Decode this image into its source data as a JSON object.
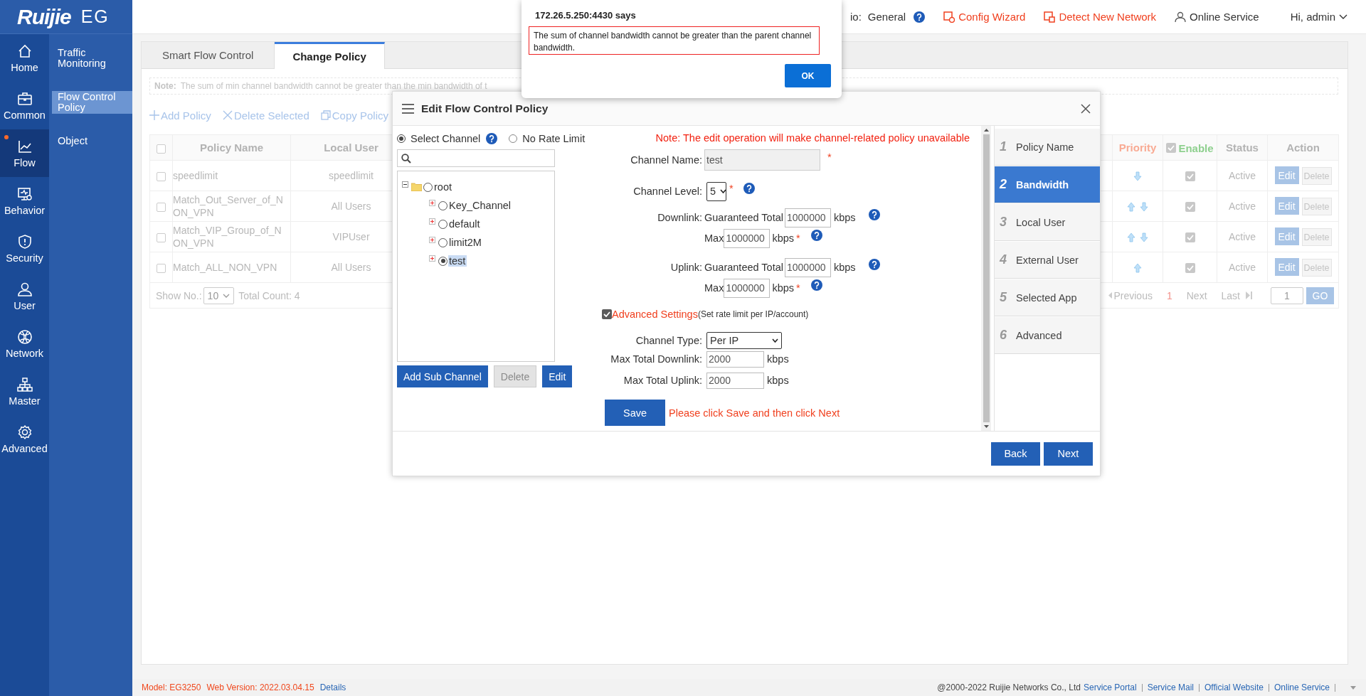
{
  "brand": {
    "logo": "Ruijie",
    "product": "EG"
  },
  "nav": {
    "items": [
      {
        "label": "Home",
        "selected": false,
        "dot": false
      },
      {
        "label": "Common",
        "selected": false,
        "dot": false
      },
      {
        "label": "Flow",
        "selected": true,
        "dot": true
      },
      {
        "label": "Behavior",
        "selected": false,
        "dot": false
      },
      {
        "label": "Security",
        "selected": false,
        "dot": false
      },
      {
        "label": "User",
        "selected": false,
        "dot": false
      },
      {
        "label": "Network",
        "selected": false,
        "dot": false
      },
      {
        "label": "Master",
        "selected": false,
        "dot": false
      },
      {
        "label": "Advanced",
        "selected": false,
        "dot": false
      }
    ],
    "subitems": [
      {
        "label": "Traffic Monitoring",
        "selected": false
      },
      {
        "label": "Flow Control Policy",
        "selected": true
      },
      {
        "label": "Object",
        "selected": false
      }
    ]
  },
  "header": {
    "scenario_label": "io:",
    "scenario": "General",
    "links": [
      {
        "label": "Config Wizard",
        "kind": "wizard"
      },
      {
        "label": "Detect New Network",
        "kind": "detect"
      },
      {
        "label": "Online Service",
        "kind": "service"
      }
    ],
    "user": "Hi, admin"
  },
  "tabs": [
    {
      "label": "Smart Flow Control",
      "selected": false
    },
    {
      "label": "Change Policy",
      "selected": true
    }
  ],
  "note": {
    "label": "Note:",
    "text": "The sum of min channel bandwidth cannot be greater than the min bandwidth of t"
  },
  "toolbar": [
    {
      "label": "Add Policy",
      "kind": "add"
    },
    {
      "label": "Delete Selected",
      "kind": "delete"
    },
    {
      "label": "Copy Policy",
      "kind": "copy"
    }
  ],
  "table": {
    "columns": {
      "policy_name": "Policy Name",
      "local_user": "Local User",
      "priority": "Priority",
      "enable": "Enable",
      "status": "Status",
      "action": "Action"
    },
    "select_all": false,
    "enable_all": true,
    "rows": [
      {
        "checked": false,
        "policy_name": "speedlimit",
        "local_user": "speedlimit",
        "priority_up": false,
        "priority_down": true,
        "enabled": true,
        "status": "Active",
        "edit": "Edit",
        "delete": "Delete"
      },
      {
        "checked": false,
        "policy_name": "Match_Out_Server_of_NON_VPN",
        "local_user": "All Users",
        "priority_up": true,
        "priority_down": true,
        "enabled": true,
        "status": "Active",
        "edit": "Edit",
        "delete": "Delete"
      },
      {
        "checked": false,
        "policy_name": "Match_VIP_Group_of_NON_VPN",
        "local_user": "VIPUser",
        "priority_up": true,
        "priority_down": true,
        "enabled": true,
        "status": "Active",
        "edit": "Edit",
        "delete": "Delete"
      },
      {
        "checked": false,
        "policy_name": "Match_ALL_NON_VPN",
        "local_user": "All Users",
        "priority_up": true,
        "priority_down": false,
        "enabled": true,
        "status": "Active",
        "edit": "Edit",
        "delete": "Delete"
      }
    ]
  },
  "pagination": {
    "show_label": "Show No.:",
    "page_size": "10",
    "total": "Total Count: 4",
    "previous": "Previous",
    "current": "1",
    "next": "Next",
    "last": "Last",
    "page_input": "1",
    "go": "GO"
  },
  "modal": {
    "title": "Edit Flow Control Policy",
    "rate_options": [
      {
        "label": "Select Channel",
        "selected": true
      },
      {
        "label": "No Rate Limit",
        "selected": false
      }
    ],
    "tree": {
      "label": "root",
      "expanded": true,
      "selected": false,
      "children": [
        {
          "label": "Key_Channel",
          "expanded": false,
          "selected": false
        },
        {
          "label": "default",
          "expanded": false,
          "selected": false
        },
        {
          "label": "limit2M",
          "expanded": false,
          "selected": false
        },
        {
          "label": "test",
          "expanded": false,
          "selected": true
        }
      ]
    },
    "tree_buttons": [
      {
        "label": "Add Sub Channel",
        "disabled": false
      },
      {
        "label": "Delete",
        "disabled": true
      },
      {
        "label": "Edit",
        "disabled": false
      }
    ],
    "note": "Note: The edit operation will make channel-related policy unavailable",
    "channel_name": {
      "label": "Channel Name:",
      "value": "test",
      "disabled": true,
      "required": "*"
    },
    "channel_level": {
      "label": "Channel Level:",
      "value": "5",
      "required": "*"
    },
    "links": [
      {
        "label": "Downlink:",
        "guaranteed_label": "Guaranteed Total",
        "guaranteed": "1000000",
        "guaranteed_unit": "kbps",
        "max_label": "Max",
        "max": "1000000",
        "max_unit": "kbps",
        "required": "*"
      },
      {
        "label": "Uplink:",
        "guaranteed_label": "Guaranteed Total",
        "guaranteed": "1000000",
        "guaranteed_unit": "kbps",
        "max_label": "Max",
        "max": "1000000",
        "max_unit": "kbps",
        "required": "*"
      }
    ],
    "advanced": {
      "checked": true,
      "label": "Advanced Settings",
      "hint": "(Set rate limit per IP/account)"
    },
    "channel_type": {
      "label": "Channel Type:",
      "value": "Per IP"
    },
    "totals": [
      {
        "label": "Max Total Downlink:",
        "value": "2000",
        "unit": "kbps"
      },
      {
        "label": "Max Total Uplink:",
        "value": "2000",
        "unit": "kbps"
      }
    ],
    "save": "Save",
    "save_hint": "Please click Save and then click Next",
    "steps": [
      {
        "number": "1",
        "label": "Policy Name",
        "selected": false
      },
      {
        "number": "2",
        "label": "Bandwidth",
        "selected": true
      },
      {
        "number": "3",
        "label": "Local User",
        "selected": false
      },
      {
        "number": "4",
        "label": "External User",
        "selected": false
      },
      {
        "number": "5",
        "label": "Selected App",
        "selected": false
      },
      {
        "number": "6",
        "label": "Advanced",
        "selected": false
      }
    ],
    "buttons": [
      "Back",
      "Next"
    ]
  },
  "alert": {
    "title": "172.26.5.250:4430 says",
    "message": "The sum of channel bandwidth cannot be greater than the parent channel bandwidth.",
    "button": "OK"
  },
  "footer": {
    "model": "Model: EG3250",
    "version": "Web Version: 2022.03.04.15",
    "details": "Details",
    "copyright": "@2000-2022 Ruijie Networks Co., Ltd",
    "links": [
      "Service Portal",
      "Service Mail",
      "Official Website",
      "Online Service"
    ]
  }
}
